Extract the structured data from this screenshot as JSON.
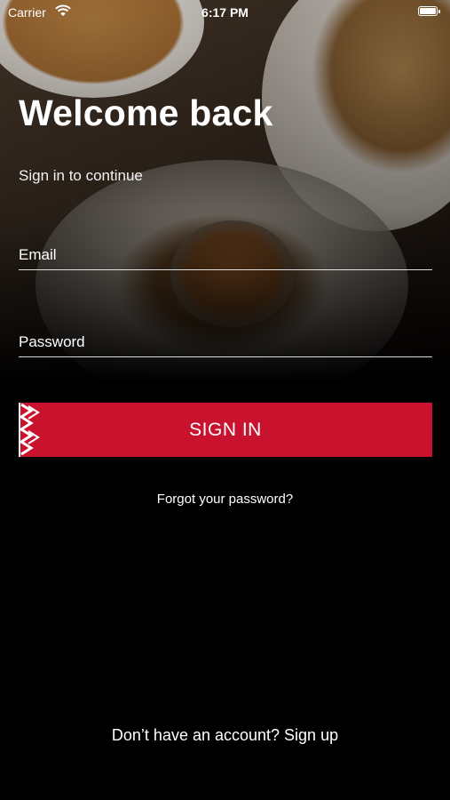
{
  "status_bar": {
    "carrier": "Carrier",
    "time": "6:17 PM",
    "wifi_icon": "wifi-icon",
    "battery_icon": "battery-icon"
  },
  "header": {
    "title": "Welcome back",
    "subtitle": "Sign in to continue"
  },
  "form": {
    "email_placeholder": "Email",
    "email_value": "",
    "password_placeholder": "Password",
    "password_value": "",
    "submit_label": "SIGN IN"
  },
  "links": {
    "forgot_password": "Forgot your password?",
    "sign_up": "Don’t have an account? Sign up"
  },
  "colors": {
    "accent": "#c8122e",
    "background": "#000000",
    "text": "#ffffff"
  }
}
